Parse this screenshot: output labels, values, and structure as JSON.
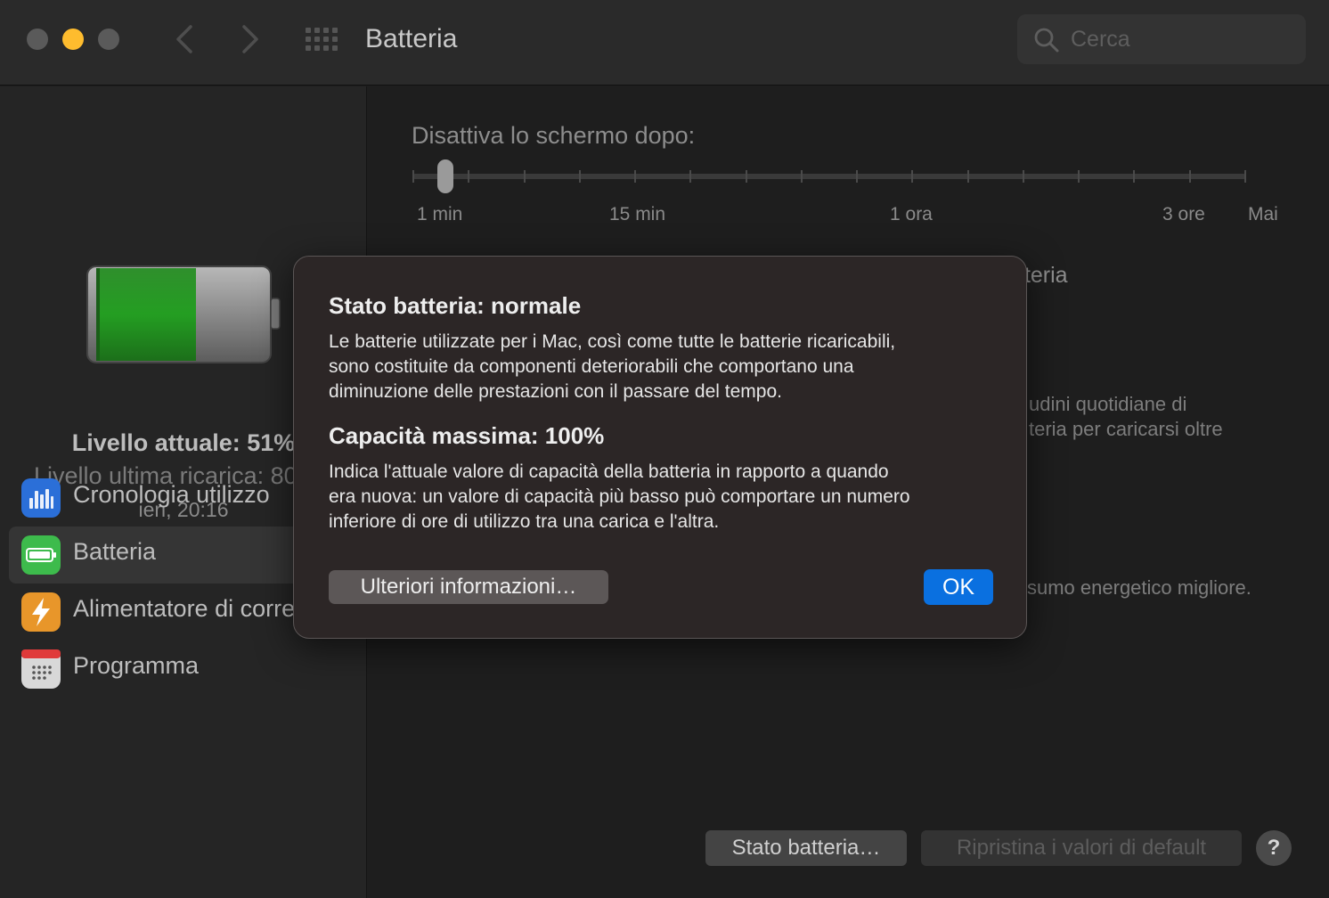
{
  "window": {
    "title": "Batteria",
    "search_placeholder": "Cerca"
  },
  "sidebar": {
    "battery_level_percent": 51,
    "current_level": "Livello attuale: 51%",
    "last_charge": "Livello ultima ricarica: 80",
    "last_charge_time": "ieri, 20:16",
    "items": [
      {
        "label": "Cronologia utilizzo",
        "icon": "usage-history-icon",
        "color": "#2b6fd8"
      },
      {
        "label": "Batteria",
        "icon": "battery-icon",
        "color": "#3dbb4c",
        "selected": true
      },
      {
        "label": "Alimentatore di corre",
        "icon": "power-adapter-icon",
        "color": "#e8962a"
      },
      {
        "label": "Programma",
        "icon": "calendar-icon",
        "color": "#d8d8d8"
      }
    ]
  },
  "main": {
    "slider_title": "Disattiva lo schermo dopo:",
    "tick_labels": [
      "1 min",
      "15 min",
      "1 ora",
      "3 ore",
      "Mai"
    ],
    "bg_heading_fragment": "tteria",
    "bg_line1_fragment": "udini quotidiane di",
    "bg_line2_fragment": "teria per caricarsi oltre",
    "bg_line3_fragment": "sumo energetico migliore.",
    "battery_status_button": "Stato batteria…",
    "restore_defaults_button": "Ripristina i valori di default",
    "help_button": "?"
  },
  "dialog": {
    "heading1": "Stato batteria: normale",
    "body1": [
      "Le batterie utilizzate per i Mac, così come tutte le batterie ricaricabili,",
      "sono costituite da componenti deteriorabili che comportano una",
      "diminuzione delle prestazioni con il passare del tempo."
    ],
    "heading2": "Capacità massima: 100%",
    "body2": [
      "Indica l'attuale valore di capacità della batteria in rapporto a quando",
      "era nuova: un valore di capacità più basso può comportare un numero",
      "inferiore di ore di utilizzo tra una carica e l'altra."
    ],
    "more_info_button": "Ulteriori informazioni…",
    "ok_button": "OK",
    "accent_color": "#0a70e0"
  }
}
